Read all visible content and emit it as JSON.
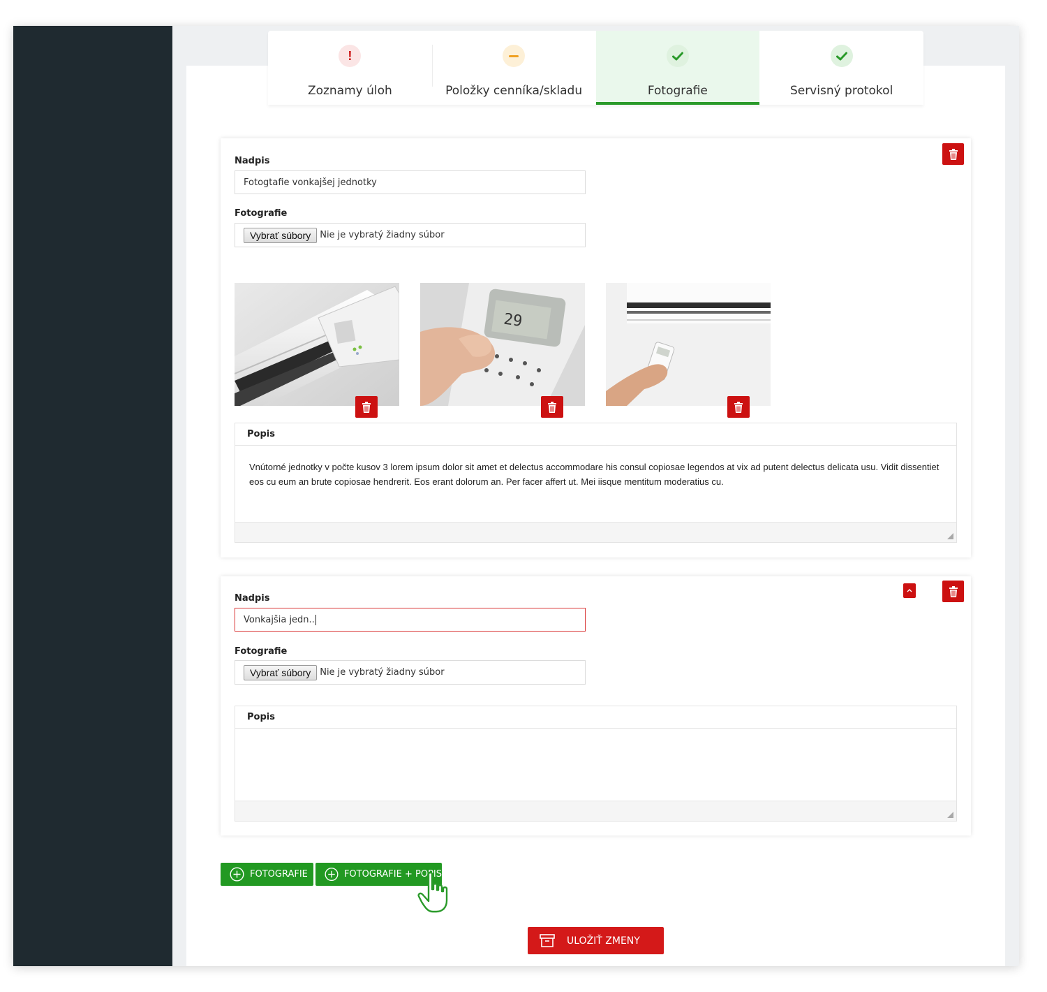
{
  "tabs": [
    {
      "label": "Zoznamy úloh",
      "status": "error",
      "icon": "exclamation-icon"
    },
    {
      "label": "Položky cenníka/skladu",
      "status": "warning",
      "icon": "minus-icon"
    },
    {
      "label": "Fotografie",
      "status": "ok",
      "icon": "check-icon",
      "active": true
    },
    {
      "label": "Servisný protokol",
      "status": "ok",
      "icon": "check-icon"
    }
  ],
  "section1": {
    "title_label": "Nadpis",
    "title_value": "Fotogtafie vonkajšej jednotky",
    "photos_label": "Fotografie",
    "file_button": "Vybrať súbory",
    "file_status": "Nie je vybratý žiadny súbor",
    "photos": [
      {
        "subject": "air-conditioner-unit-open"
      },
      {
        "subject": "remote-control-in-hand"
      },
      {
        "subject": "hand-pointing-remote-at-unit"
      }
    ],
    "description_label": "Popis",
    "description": "Vnútorné jednotky v počte kusov 3 lorem ipsum dolor sit amet et delectus accommodare his consul copiosae legendos at vix ad putent delectus delicata usu. Vidit dissentiet eos cu eum an brute copiosae hendrerit. Eos erant dolorum an. Per facer affert ut. Mei iisque mentitum moderatius cu."
  },
  "section2": {
    "title_label": "Nadpis",
    "title_value": "Vonkajšia jedn..",
    "photos_label": "Fotografie",
    "file_button": "Vybrať súbory",
    "file_status": "Nie je vybratý žiadny súbor",
    "description_label": "Popis",
    "description": ""
  },
  "actions": {
    "add_photo": "FOTOGRAFIE",
    "add_photo_description": "FOTOGRAFIE + POPIS",
    "save": "ULOŽIŤ ZMENY"
  },
  "colors": {
    "sidebar": "#1f2a30",
    "accent_green": "#229922",
    "accent_red": "#cc1111",
    "active_tab_bg": "#eaf8ec"
  }
}
